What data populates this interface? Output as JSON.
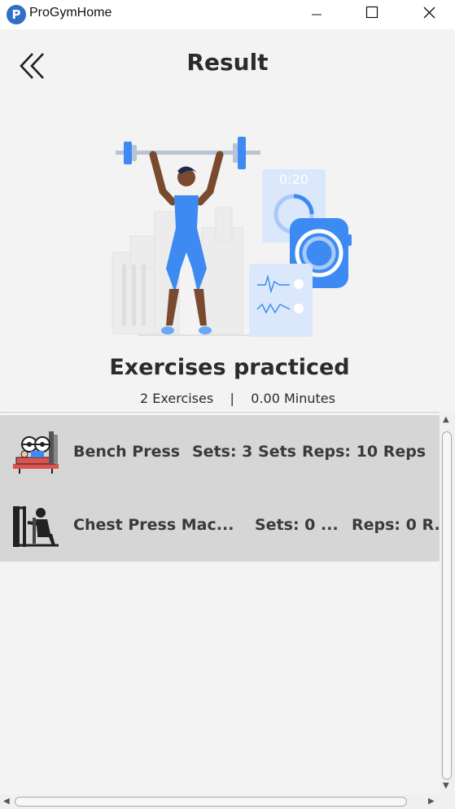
{
  "window": {
    "title": "ProGymHome",
    "icon_letter": "P"
  },
  "header": {
    "title": "Result",
    "back_icon": "double-chevron-left-icon"
  },
  "illustration": {
    "timer_text": "0:20"
  },
  "section": {
    "title": "Exercises practiced",
    "summary": "2 Exercises    |    0.00 Minutes"
  },
  "exercises": [
    {
      "name": "Bench Press",
      "sets": "Sets: 3 Sets",
      "reps": "Reps: 10 Reps",
      "icon": "bench-press-icon"
    },
    {
      "name": "Chest Press Mac...",
      "sets": "Sets: 0 ...",
      "reps": "Reps: 0 R...",
      "icon": "chest-press-machine-icon"
    }
  ],
  "colors": {
    "accent": "#3d8bf2",
    "list_row_bg": "#d6d6d6"
  }
}
